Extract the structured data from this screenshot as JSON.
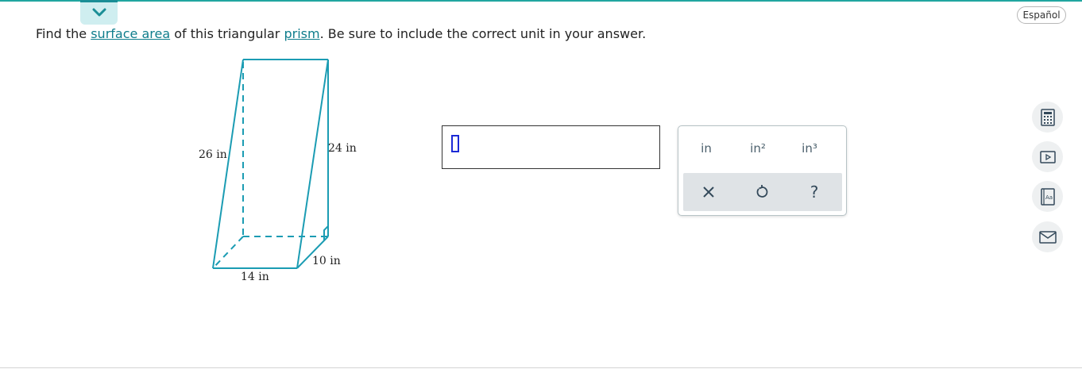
{
  "header": {
    "collapse_icon": "chevron-down-icon",
    "language_button_label": "Español"
  },
  "question": {
    "prefix": "Find the ",
    "link_surface_area": "surface area",
    "middle": " of this triangular ",
    "link_prism": "prism",
    "suffix": ". Be sure to include the correct unit in your answer."
  },
  "figure": {
    "labels": {
      "slant_edge": "26 in",
      "vertical_edge": "24 in",
      "depth_edge": "10 in",
      "base_edge": "14 in"
    }
  },
  "answer": {
    "value": ""
  },
  "palette": {
    "units": [
      "in",
      "in²",
      "in³"
    ],
    "actions": [
      {
        "name": "clear",
        "icon": "close-icon"
      },
      {
        "name": "undo",
        "icon": "undo-icon"
      },
      {
        "name": "help",
        "icon": "help-icon"
      }
    ]
  },
  "side_tools": [
    {
      "name": "calculator",
      "icon": "calculator-icon"
    },
    {
      "name": "video",
      "icon": "video-icon"
    },
    {
      "name": "glossary",
      "icon": "glossary-icon"
    },
    {
      "name": "message",
      "icon": "mail-icon"
    }
  ],
  "colors": {
    "accent": "#1a8e96",
    "figure_stroke": "#1b9cb3",
    "link": "#0f7d8c",
    "caret": "#1c2ad6"
  }
}
